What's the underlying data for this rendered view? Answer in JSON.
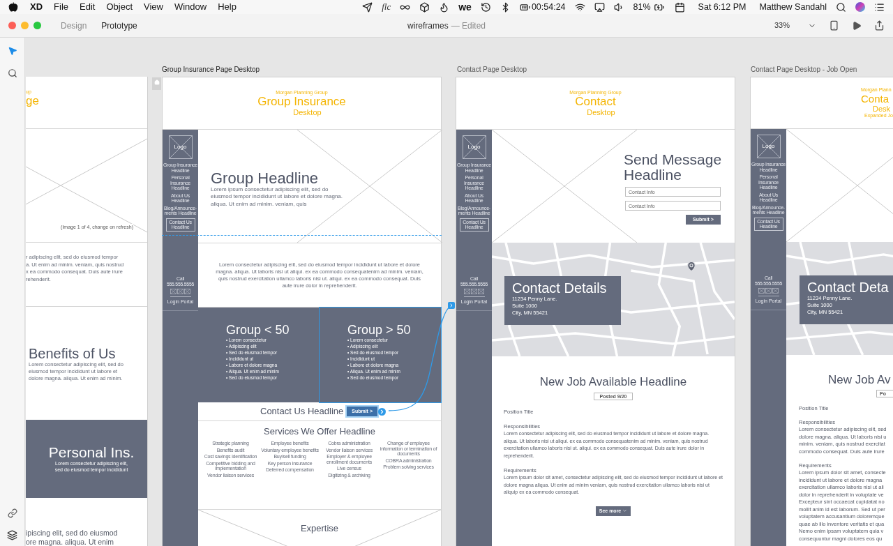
{
  "menu_bar": {
    "app": "XD",
    "menus": [
      "File",
      "Edit",
      "Object",
      "View",
      "Window",
      "Help"
    ],
    "logo_text_1": "flc",
    "logo_text_2": "we",
    "timer": "00:54:24",
    "battery": "81%",
    "datetime": "Sat 6:12 PM",
    "user": "Matthew Sandahl"
  },
  "title_bar": {
    "tabs": [
      {
        "label": "Design",
        "selected": false
      },
      {
        "label": "Prototype",
        "selected": true
      }
    ],
    "document": "wireframes",
    "status": "— Edited",
    "zoom": "33%"
  },
  "tools": [
    {
      "kind": "select",
      "selected": true
    },
    {
      "kind": "search",
      "selected": false
    }
  ],
  "left_artboard": {
    "brand_fragment": "up",
    "title_fragment": "ge",
    "image_caption": "(Image 1 of 4, change on refresh)",
    "intro_lines": [
      "r adipiscing elit, sed do eiusmod tempor",
      "a. Ut enim ad minim. veniam, quis nostrud",
      "x ea commodo consequat. Duis aute irure",
      "rehenderit."
    ],
    "benefits_title": "Benefits of Us",
    "benefits_lines": [
      "Lorem consectetur adipiscing elit, sed do",
      "eiusmod tempor incididunt ut labore et",
      "dolore magna. aliqua. Ut enim ad minim."
    ],
    "personal_title": "Personal Ins.",
    "personal_lines": [
      "Lorem consectetur adipiscing elit,",
      "sed do eiusmod tempor incididunt"
    ],
    "footer_lines": [
      "ipiscing elit, sed do eiusmod",
      "ore magna. aliqua. Ut enim"
    ]
  },
  "group_insurance": {
    "label": "Group Insurance Page Desktop",
    "header": {
      "brand": "Morgan Planning Group",
      "title": "Group Insurance",
      "subtitle": "Desktop"
    },
    "sidebar": {
      "logo": "Logo",
      "nav": [
        {
          "label": "Group Insurance Headline",
          "selected": false
        },
        {
          "label": "Personal Insurance Headline",
          "selected": false
        },
        {
          "label": "About Us Headline",
          "selected": false
        },
        {
          "label": "Blog/Announce-ments Headline",
          "selected": false
        },
        {
          "label": "Contact Us Headline",
          "selected": true
        }
      ],
      "phone": "Call 555.555.5555",
      "login": "Login Portal"
    },
    "hero": {
      "headline": "Group Headline",
      "text": "Lorem ipsum consectetur adipiscing elit, sed do eiusmod tempor incididunt ut labore et dolore magna. aliqua. Ut enim ad minim. veniam, quis"
    },
    "intro": "Lorem consectetur adipiscing elit, sed do eiusmod tempor incididunt ut labore et dolore magna. aliqua. Ut laboris nisi ut aliqui. ex ea commodo consequatenim ad minim. veniam, quis nostrud exercitation ullamco laboris nisi ut. aliqui. ex ea commodo consequat. Duis aute irure dolor in reprehenderit.",
    "groups": [
      {
        "title": "Group < 50",
        "selected": false,
        "bullets": [
          "• Lorem consectetur",
          "• Adipiscing elit",
          "• Sed do eiusmod tempor",
          "• Incididunt ut",
          "• Labore et dolore magna",
          "• Aliqua. Ut enim ad minim",
          "• Sed do eiusmod tempor"
        ]
      },
      {
        "title": "Group > 50",
        "selected": true,
        "bullets": [
          "• Lorem consectetur",
          "• Adipiscing elit",
          "• Sed do eiusmod tempor",
          "• Incididunt ut",
          "• Labore et dolore magna",
          "• Aliqua. Ut enim ad minim",
          "• Sed do eiusmod tempor"
        ]
      }
    ],
    "contact": {
      "headline": "Contact Us Headline",
      "button": "Submit >",
      "selected": true
    },
    "services": {
      "headline": "Services We Offer Headline",
      "columns": [
        [
          "Strategic planning",
          "Benefits audit",
          "Cost savings identification",
          "Competitive bidding and implementation",
          "Vendor liaison services"
        ],
        [
          "Employee benefits",
          "Voluntary employee benefits",
          "Buy/sell funding",
          "Key person insurance",
          "Deferred compensation"
        ],
        [
          "Cobra administration",
          "Vendor liaison services",
          "Employer & employee enrollment documents",
          "Live census",
          "Digitizing & archiving"
        ],
        [
          "Change of employee information or termination of documents",
          "COBRA administration",
          "Problem solving services"
        ]
      ]
    },
    "expertise": "Expertise"
  },
  "contact_page": {
    "label": "Contact Page Desktop",
    "header": {
      "brand": "Morgan Planning Group",
      "title": "Contact",
      "subtitle": "Desktop"
    },
    "sidebar": {
      "logo": "Logo",
      "nav": [
        {
          "label": "Group Insurance Headline",
          "selected": false
        },
        {
          "label": "Personal Insurance Headline",
          "selected": false
        },
        {
          "label": "About Us Headline",
          "selected": false
        },
        {
          "label": "Blog/Announce-ments Headline",
          "selected": false
        },
        {
          "label": "Contact Us Headline",
          "selected": true
        }
      ],
      "phone": "Call 555.555.5555",
      "login": "Login Portal"
    },
    "hero": {
      "headline": "Send Message Headline",
      "fields": [
        {
          "placeholder": "Contact Info"
        },
        {
          "placeholder": "Contact Info"
        }
      ],
      "button": "Submit >"
    },
    "details": {
      "title": "Contact Details",
      "address": [
        "11234 Penny Lane.",
        "Suite 1000",
        "City, MN 55421"
      ]
    },
    "job": {
      "headline": "New Job Available Headline",
      "badge": "Posted 9/20",
      "position": "Position Title",
      "sections": [
        {
          "title": "Responsibilities",
          "text": "Lorem consectetur adipiscing elit, sed do eiusmod tempor incididunt ut labore et dolore magna. aliqua. Ut laboris nisi ut aliqui. ex ea commodo consequatenim ad minim. veniam, quis nostrud exercitation ullamco laboris nisi ut. aliqui. ex ea commodo consequat. Duis aute irure dolor in reprehenderit."
        },
        {
          "title": "Requirements",
          "text": "Lorem ipsum dolor sit amet, consectetur adipiscing elit, sed do eiusmod tempor incididunt ut labore et dolore magna aliqua. Ut enim ad minim veniam, quis nostrud exercitation ullamco laboris nisi ut aliquip ex ea commodo consequat."
        }
      ],
      "button": "See more"
    }
  },
  "job_open_page": {
    "label": "Contact Page Desktop - Job Open",
    "header": {
      "brand": "Morgan Plann",
      "title": "Conta",
      "subtitle": "Desk",
      "note": "Expanded Jo"
    },
    "sidebar": {
      "logo": "Logo",
      "nav": [
        {
          "label": "Group Insurance Headline",
          "selected": false
        },
        {
          "label": "Personal Insurance Headline",
          "selected": false
        },
        {
          "label": "About Us Headline",
          "selected": false
        },
        {
          "label": "Blog/Announce-ments Headline",
          "selected": false
        },
        {
          "label": "Contact Us Headline",
          "selected": true
        }
      ],
      "phone": "Call 555.555.5555",
      "login": "Login Portal"
    },
    "details": {
      "title": "Contact Deta",
      "address": [
        "11234 Penny Lane.",
        "Suite 1000",
        "City, MN 55421"
      ]
    },
    "job": {
      "headline": "New Job Av",
      "badge": "Po",
      "position": "Position Title",
      "sections": [
        {
          "title": "Responsibilities",
          "lines": [
            "Lorem consectetur adipiscing elit, sed",
            "dolore magna. aliqua. Ut laboris nisi u",
            "minim. veniam, quis nostrud exercitat",
            "commodo consequat. Duis aute irure"
          ]
        },
        {
          "title": "Requirements",
          "lines": [
            "Lorem ipsum dolor sit amet, consecte",
            "incididunt ut labore et dolore magna",
            "exercitation ullamco laboris nisi ut ali",
            "dolor in reprehenderit in voluptate ve",
            "Excepteur sint occaecat cupidatat no",
            "mollit anim id est laborum. Sed ut per",
            "voluptatem accusantium doloremque",
            "quae ab illo inventore veritatis et qua",
            "Nemo enim ipsam voluptatem quia v",
            "consequuntur magni dolores eos qu"
          ]
        }
      ]
    }
  }
}
